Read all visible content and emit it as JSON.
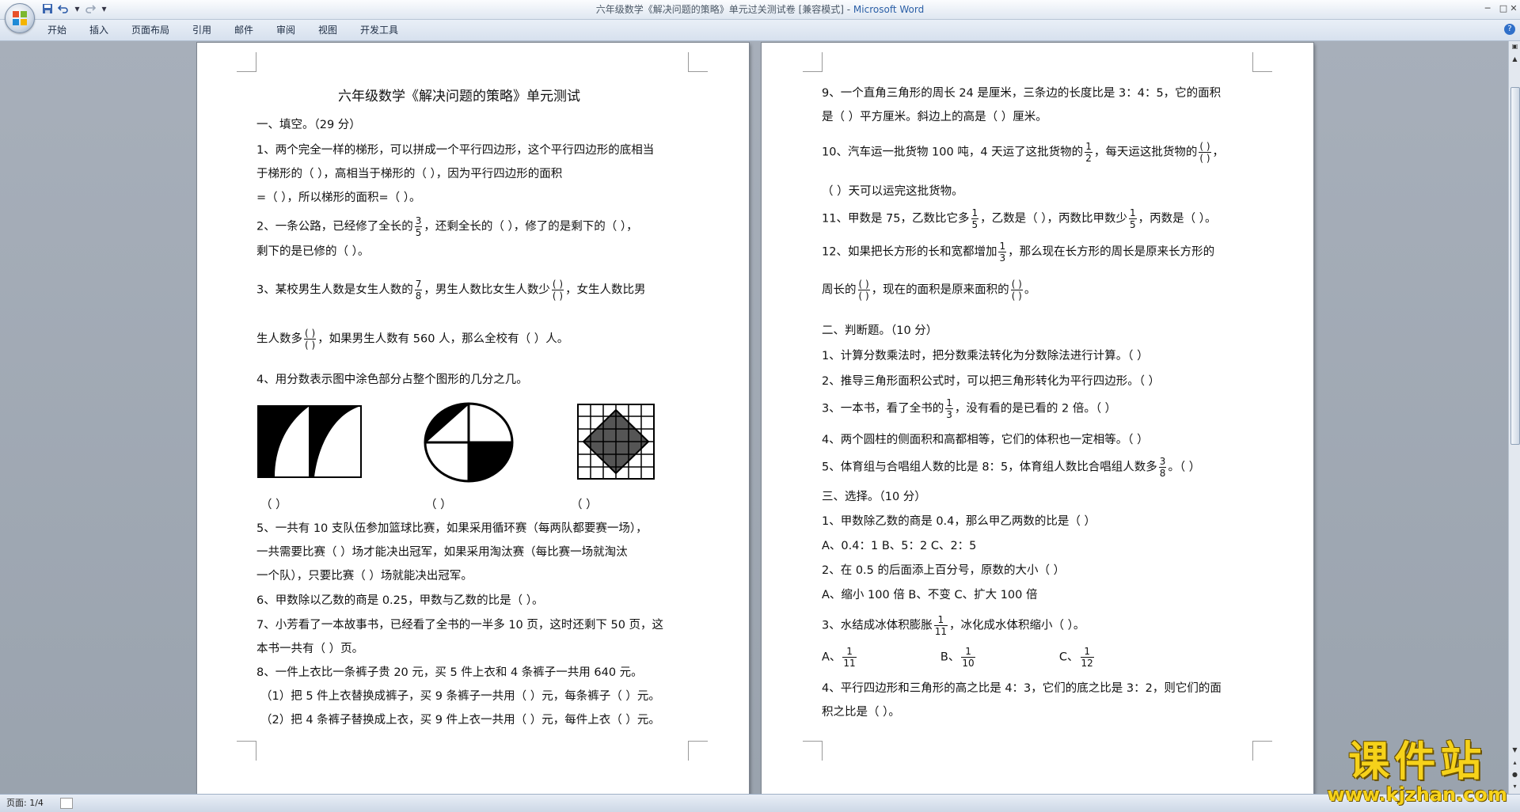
{
  "window": {
    "title_doc": "六年级数学《解决问题的策略》单元过关测试卷 [兼容模式] - ",
    "title_app": "Microsoft Word"
  },
  "quick_access": {
    "save_icon": "save-icon",
    "undo_icon": "undo-icon",
    "redo_icon": "redo-icon",
    "more_icon": "dropdown-icon"
  },
  "ribbon_tabs": [
    "开始",
    "插入",
    "页面布局",
    "引用",
    "邮件",
    "审阅",
    "视图",
    "开发工具"
  ],
  "status": {
    "page_count": "页面: 1/4"
  },
  "page1": {
    "title": "六年级数学《解决问题的策略》单元测试",
    "s1_heading": "一、填空。（29 分）",
    "q1_l1": "1、两个完全一样的梯形，可以拼成一个平行四边形，这个平行四边形的底相当",
    "q1_l2": "于梯形的（          ），高相当于梯形的（          ），因为平行四边形的面积",
    "q1_l3": "=（          ），所以梯形的面积=（                        ）。",
    "q2_a": "2、一条公路，已经修了全长的",
    "q2_f_n": "3",
    "q2_f_d": "5",
    "q2_b": "，还剩全长的（    ），修了的是剩下的（    ），",
    "q2_l2": "剩下的是已修的（    ）。",
    "q3_a": "3、某校男生人数是女生人数的",
    "q3_f1_n": "7",
    "q3_f1_d": "8",
    "q3_b": "，男生人数比女生人数少",
    "q3_f2_n": "( )",
    "q3_f2_d": "( )",
    "q3_c": "，女生人数比男",
    "q3_l2_a": "生人数多",
    "q3_f3_n": "( )",
    "q3_f3_d": "( )",
    "q3_l2_b": "，如果男生人数有 560 人，那么全校有（      ）人。",
    "q4": "4、用分数表示图中涂色部分占整个图形的几分之几。",
    "q4_blank1": "（          ）",
    "q4_blank2": "（          ）",
    "q4_blank3": "（          ）",
    "q5_l1": "5、一共有 10 支队伍参加篮球比赛，如果采用循环赛（每两队都要赛一场），",
    "q5_l2": "一共需要比赛（      ）场才能决出冠军，如果采用淘汰赛（每比赛一场就淘汰",
    "q5_l3": "一个队），只要比赛（      ）场就能决出冠军。",
    "q6": "6、甲数除以乙数的商是 0.25，甲数与乙数的比是（      ）。",
    "q7_l1": "7、小芳看了一本故事书，已经看了全书的一半多 10 页，这时还剩下 50 页，这",
    "q7_l2": "本书一共有（      ）页。",
    "q8_l1": "8、一件上衣比一条裤子贵 20 元，买 5 件上衣和 4 条裤子一共用 640 元。",
    "q8_l2": "（1）把 5 件上衣替换成裤子，买 9 条裤子一共用（   ）元，每条裤子（   ）元。",
    "q8_l3": "（2）把 4 条裤子替换成上衣，买 9 件上衣一共用（   ）元，每件上衣（   ）元。"
  },
  "page2": {
    "q9_l1": "9、一个直角三角形的周长 24 是厘米，三条边的长度比是 3：4：5，它的面积",
    "q9_l2": "是（      ）平方厘米。斜边上的高是（      ）厘米。",
    "q10_a": "10、汽车运一批货物 100 吨，4 天运了这批货物的",
    "q10_f1_n": "1",
    "q10_f1_d": "2",
    "q10_b": "，每天运这批货物的",
    "q10_f2_n": "( )",
    "q10_f2_d": "( )",
    "q10_c": "，",
    "q10_l2": "（      ）天可以运完这批货物。",
    "q11_a": "11、甲数是 75，乙数比它多",
    "q11_f1_n": "1",
    "q11_f1_d": "5",
    "q11_b": "，乙数是（      ），丙数比甲数少",
    "q11_f2_n": "1",
    "q11_f2_d": "5",
    "q11_c": "，丙数是（      ）。",
    "q12_a": "12、如果把长方形的长和宽都增加",
    "q12_f1_n": "1",
    "q12_f1_d": "3",
    "q12_b": "，那么现在长方形的周长是原来长方形的",
    "q12_l2_a": "周长的",
    "q12_f2_n": "( )",
    "q12_f2_d": "( )",
    "q12_l2_b": "，现在的面积是原来面积的",
    "q12_f3_n": "( )",
    "q12_f3_d": "( )",
    "q12_l2_c": "。",
    "s2_heading": "二、判断题。（10 分）",
    "j1": "1、计算分数乘法时，把分数乘法转化为分数除法进行计算。（      ）",
    "j2": "2、推导三角形面积公式时，可以把三角形转化为平行四边形。（      ）",
    "j3_a": "3、一本书，看了全书的",
    "j3_f_n": "1",
    "j3_f_d": "3",
    "j3_b": "，没有看的是已看的 2 倍。（      ）",
    "j4": "4、两个圆柱的侧面积和高都相等，它们的体积也一定相等。（      ）",
    "j5_a": "5、体育组与合唱组人数的比是 8：5，体育组人数比合唱组人数多",
    "j5_f_n": "3",
    "j5_f_d": "8",
    "j5_b": "。（      ）",
    "s3_heading": "三、选择。（10 分）",
    "c1": "1、甲数除乙数的商是 0.4，那么甲乙两数的比是（        ）",
    "c1_opts": "A、0.4：1              B、5：2              C、2：5",
    "c2": "2、在 0.5 的后面添上百分号，原数的大小（        ）",
    "c2_opts": "A、缩小 100 倍              B、不变              C、扩大 100 倍",
    "c3_a": "3、水结成冰体积膨胀",
    "c3_f_n": "1",
    "c3_f_d": "11",
    "c3_b": "，冰化成水体积缩小（            ）。",
    "c3_A": "A、",
    "c3_A_n": "1",
    "c3_A_d": "11",
    "c3_B": "B、",
    "c3_B_n": "1",
    "c3_B_d": "10",
    "c3_C": "C、",
    "c3_C_n": "1",
    "c3_C_d": "12",
    "c4_l1": "4、平行四边形和三角形的高之比是 4：3，它们的底之比是 3：2，则它们的面",
    "c4_l2": "积之比是（          ）。"
  },
  "watermark": {
    "cn": "课件站",
    "url": "www.kjzhan.com"
  }
}
